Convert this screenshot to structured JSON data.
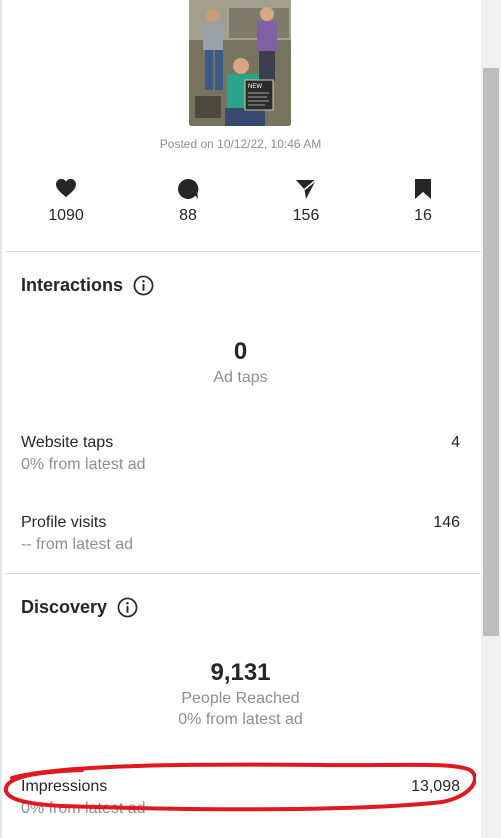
{
  "post": {
    "posted_text": "Posted on 10/12/22, 10:46 AM",
    "image_caption_board": "NEW"
  },
  "stats": [
    {
      "icon": "heart-icon",
      "value": "1090"
    },
    {
      "icon": "comment-icon",
      "value": "88"
    },
    {
      "icon": "send-icon",
      "value": "156"
    },
    {
      "icon": "bookmark-icon",
      "value": "16"
    }
  ],
  "interactions": {
    "title": "Interactions",
    "ad_taps": {
      "value": "0",
      "label": "Ad taps"
    },
    "website_taps": {
      "label": "Website taps",
      "value": "4",
      "sub": "0% from latest ad"
    },
    "profile_visits": {
      "label": "Profile visits",
      "value": "146",
      "sub": "-- from latest ad"
    }
  },
  "discovery": {
    "title": "Discovery",
    "reached": {
      "value": "9,131",
      "label": "People Reached",
      "sub": "0% from latest ad"
    },
    "impressions": {
      "label": "Impressions",
      "value": "13,098",
      "sub": "0% from latest ad"
    }
  },
  "colors": {
    "highlight": "#e0191f",
    "muted": "#8e8e8e",
    "text": "#262626"
  }
}
